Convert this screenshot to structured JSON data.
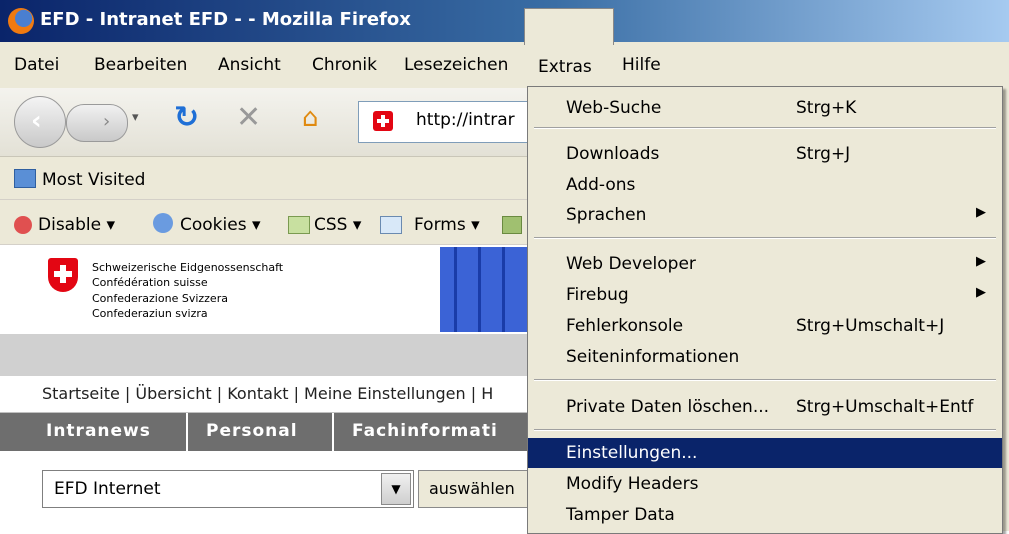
{
  "window": {
    "title": "EFD - Intranet EFD - - Mozilla Firefox"
  },
  "menubar": {
    "items": [
      "Datei",
      "Bearbeiten",
      "Ansicht",
      "Chronik",
      "Lesezeichen",
      "Extras",
      "Hilfe"
    ],
    "active": "Extras"
  },
  "navbar": {
    "url": "http://intrar"
  },
  "bookmarks": {
    "most_visited": "Most Visited"
  },
  "webdev": {
    "disable": "Disable ▾",
    "cookies": "Cookies ▾",
    "css": "CSS ▾",
    "forms": "Forms ▾"
  },
  "page": {
    "confederation": [
      "Schweizerische Eidgenossenschaft",
      "Confédération suisse",
      "Confederazione Svizzera",
      "Confederaziun svizra"
    ],
    "links": "Startseite | Übersicht | Kontakt | Meine Einstellungen | H",
    "tabs": [
      "Intranews",
      "Personal",
      "Fachinformati"
    ],
    "select_value": "EFD Internet",
    "select_button": "auswählen"
  },
  "extras_menu": {
    "items": [
      {
        "label": "Web-Suche",
        "shortcut": "Strg+K"
      },
      {
        "label": "Downloads",
        "shortcut": "Strg+J"
      },
      {
        "label": "Add-ons",
        "shortcut": ""
      },
      {
        "label": "Sprachen",
        "shortcut": "",
        "submenu": true
      },
      {
        "label": "Web Developer",
        "shortcut": "",
        "submenu": true
      },
      {
        "label": "Firebug",
        "shortcut": "",
        "submenu": true
      },
      {
        "label": "Fehlerkonsole",
        "shortcut": "Strg+Umschalt+J"
      },
      {
        "label": "Seiteninformationen",
        "shortcut": ""
      },
      {
        "label": "Private Daten löschen...",
        "shortcut": "Strg+Umschalt+Entf"
      },
      {
        "label": "Einstellungen...",
        "shortcut": "",
        "highlighted": true
      },
      {
        "label": "Modify Headers",
        "shortcut": ""
      },
      {
        "label": "Tamper Data",
        "shortcut": ""
      }
    ]
  },
  "colors": {
    "highlight": "#0a246a",
    "menu_bg": "#ece9d8",
    "swiss_red": "#e30613"
  }
}
